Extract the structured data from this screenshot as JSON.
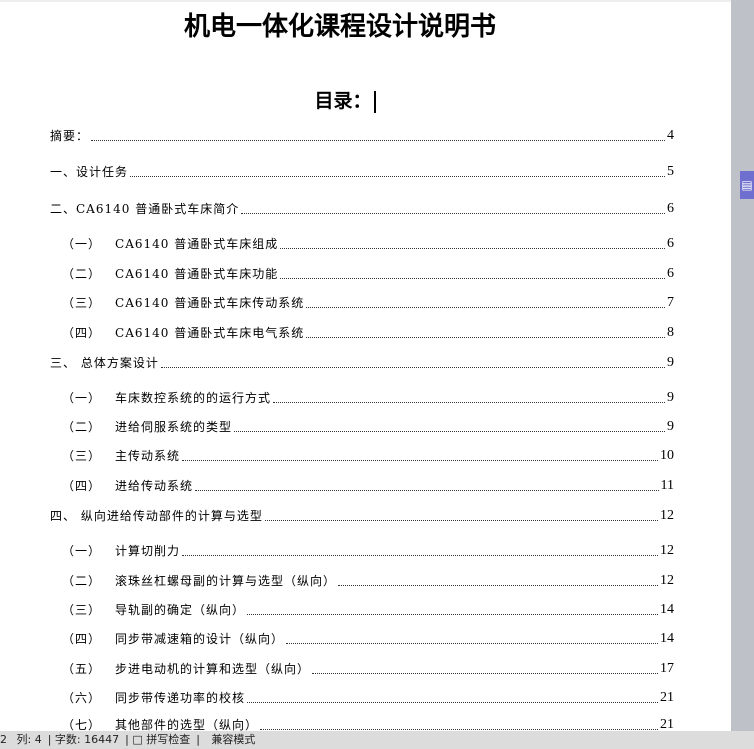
{
  "title": "机电一体化课程设计说明书",
  "toc_heading": "目录：",
  "toc": [
    {
      "num": "",
      "text": "摘要：",
      "page": "4",
      "level": 1
    },
    {
      "num": "",
      "text": "一、设计任务",
      "page": "5",
      "level": 1
    },
    {
      "num": "",
      "text": "二、CA6140 普通卧式车床简介",
      "page": "6",
      "level": 1
    },
    {
      "num": "（一）",
      "text": "CA6140 普通卧式车床组成",
      "page": "6",
      "level": 2
    },
    {
      "num": "（二）",
      "text": "CA6140 普通卧式车床功能",
      "page": "6",
      "level": 2
    },
    {
      "num": "（三）",
      "text": "CA6140 普通卧式车床传动系统",
      "page": "7",
      "level": 2
    },
    {
      "num": "（四）",
      "text": "CA6140 普通卧式车床电气系统",
      "page": "8",
      "level": 2
    },
    {
      "num": "",
      "text": "三、 总体方案设计",
      "page": "9",
      "level": 1
    },
    {
      "num": "（一）",
      "text": "车床数控系统的的运行方式",
      "page": "9",
      "level": 2
    },
    {
      "num": "（二）",
      "text": "进给伺服系统的类型",
      "page": "9",
      "level": 2
    },
    {
      "num": "（三）",
      "text": "主传动系统",
      "page": "10",
      "level": 2
    },
    {
      "num": "（四）",
      "text": "进给传动系统",
      "page": "11",
      "level": 2
    },
    {
      "num": "",
      "text": "四、 纵向进给传动部件的计算与选型",
      "page": "12",
      "level": 1
    },
    {
      "num": "（一）",
      "text": "计算切削力",
      "page": "12",
      "level": 2
    },
    {
      "num": "（二）",
      "text": "滚珠丝杠螺母副的计算与选型（纵向）",
      "page": "12",
      "level": 2
    },
    {
      "num": "（三）",
      "text": "导轨副的确定（纵向）",
      "page": "14",
      "level": 2
    },
    {
      "num": "（四）",
      "text": "同步带减速箱的设计（纵向）",
      "page": "14",
      "level": 2
    },
    {
      "num": "（五）",
      "text": "步进电动机的计算和选型（纵向）",
      "page": "17",
      "level": 2
    },
    {
      "num": "（六）",
      "text": "同步带传递功率的校核",
      "page": "21",
      "level": 2
    },
    {
      "num": "（七）",
      "text": "其他部件的选型（纵向）",
      "page": "21",
      "level": 2
    }
  ],
  "status": {
    "line": "2",
    "col": "列: 4",
    "words": "字数: 16447",
    "spell": "□ 拼写检查",
    "mode": "兼容模式"
  }
}
